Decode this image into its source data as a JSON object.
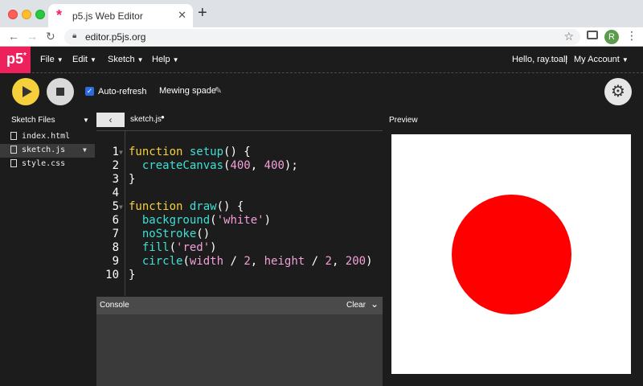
{
  "browser": {
    "tab_title": "p5.js Web Editor",
    "tab_favicon": "p5-asterisk-icon",
    "url": "editor.p5js.org",
    "profile_initial": "R"
  },
  "appnav": {
    "logo": "p5",
    "logo_sup": "*",
    "menus": [
      "File",
      "Edit",
      "Sketch",
      "Help"
    ],
    "greeting": "Hello, ray.toal!",
    "separator": "|",
    "account": "My Account"
  },
  "toolbar": {
    "auto_refresh_label": "Auto-refresh",
    "auto_refresh_checked": true,
    "sketch_name": "Mewing spade"
  },
  "sidebar": {
    "header": "Sketch Files",
    "files": [
      {
        "name": "index.html",
        "active": false
      },
      {
        "name": "sketch.js",
        "active": true
      },
      {
        "name": "style.css",
        "active": false
      }
    ]
  },
  "editor": {
    "file_tab": "sketch.js",
    "lines": [
      {
        "n": "1",
        "fold": true,
        "tokens": [
          [
            "kw",
            "function "
          ],
          [
            "fn",
            "setup"
          ],
          [
            "punc",
            "() {"
          ]
        ]
      },
      {
        "n": "2",
        "fold": false,
        "tokens": [
          [
            "punc",
            "  "
          ],
          [
            "fn",
            "createCanvas"
          ],
          [
            "punc",
            "("
          ],
          [
            "num",
            "400"
          ],
          [
            "punc",
            ", "
          ],
          [
            "num",
            "400"
          ],
          [
            "punc",
            ");"
          ]
        ]
      },
      {
        "n": "3",
        "fold": false,
        "tokens": [
          [
            "punc",
            "}"
          ]
        ]
      },
      {
        "n": "4",
        "fold": false,
        "tokens": []
      },
      {
        "n": "5",
        "fold": true,
        "tokens": [
          [
            "kw",
            "function "
          ],
          [
            "fn",
            "draw"
          ],
          [
            "punc",
            "() {"
          ]
        ]
      },
      {
        "n": "6",
        "fold": false,
        "tokens": [
          [
            "punc",
            "  "
          ],
          [
            "fn",
            "background"
          ],
          [
            "punc",
            "("
          ],
          [
            "str",
            "'white'"
          ],
          [
            "punc",
            ")"
          ]
        ]
      },
      {
        "n": "7",
        "fold": false,
        "tokens": [
          [
            "punc",
            "  "
          ],
          [
            "fn",
            "noStroke"
          ],
          [
            "punc",
            "()"
          ]
        ]
      },
      {
        "n": "8",
        "fold": false,
        "tokens": [
          [
            "punc",
            "  "
          ],
          [
            "fn",
            "fill"
          ],
          [
            "punc",
            "("
          ],
          [
            "str",
            "'red'"
          ],
          [
            "punc",
            ")"
          ]
        ]
      },
      {
        "n": "9",
        "fold": false,
        "tokens": [
          [
            "punc",
            "  "
          ],
          [
            "fn",
            "circle"
          ],
          [
            "punc",
            "("
          ],
          [
            "num",
            "width"
          ],
          [
            "punc",
            " / "
          ],
          [
            "num",
            "2"
          ],
          [
            "punc",
            ", "
          ],
          [
            "num",
            "height"
          ],
          [
            "punc",
            " / "
          ],
          [
            "num",
            "2"
          ],
          [
            "punc",
            ", "
          ],
          [
            "num",
            "200"
          ],
          [
            "punc",
            ")"
          ]
        ]
      },
      {
        "n": "10",
        "fold": false,
        "tokens": [
          [
            "punc",
            "}"
          ]
        ]
      }
    ]
  },
  "console": {
    "title": "Console",
    "clear_label": "Clear"
  },
  "preview": {
    "label": "Preview",
    "background": "#ffffff",
    "circle_color": "#ff0000"
  }
}
